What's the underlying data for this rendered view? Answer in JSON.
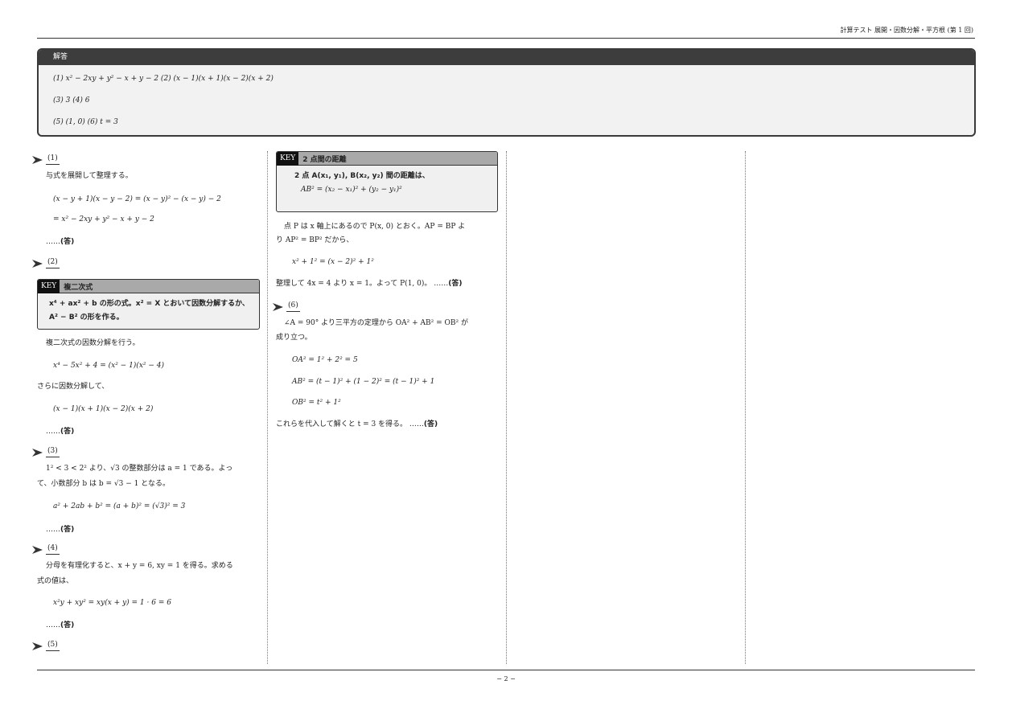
{
  "header": {
    "running_title": "計算テスト 展開・因数分解・平方根 (第 1 回)"
  },
  "answers": {
    "title": "解答",
    "line1": "(1) x² − 2xy + y² − x + y − 2    (2) (x − 1)(x + 1)(x − 2)(x + 2)",
    "line2": "(3) 3    (4) 6",
    "line3": "(5) (1, 0)    (6) t = 3"
  },
  "col1": {
    "q1": {
      "num": "(1)",
      "intro": "与式を展開して整理する。",
      "eq1": "(x − y + 1)(x − y − 2) = (x − y)² − (x − y) − 2",
      "eq2": "= x² − 2xy + y² − x + y − 2",
      "ans_dots": "……",
      "ans_mark": "(答)"
    },
    "q2": {
      "num": "(2)",
      "key_tag": "KEY",
      "key_title": "複二次式",
      "key_body": "x⁴ + ax² + b の形の式。x² = X とおいて因数分解するか、A² − B² の形を作る。",
      "text1": "複二次式の因数分解を行う。",
      "eq1": "x⁴ − 5x² + 4 = (x² − 1)(x² − 4)",
      "text2": "さらに因数分解して、",
      "eq2": "(x − 1)(x + 1)(x − 2)(x + 2)",
      "ans_dots": "……",
      "ans_mark": "(答)"
    },
    "q3": {
      "num": "(3)",
      "text1": "1² < 3 < 2² より、√3 の整数部分は a = 1 である。よっ",
      "text2": "て、小数部分 b は b = √3 − 1 となる。",
      "eq1": "a² + 2ab + b² = (a + b)² = (√3)² = 3",
      "ans_dots": "……",
      "ans_mark": "(答)"
    },
    "q4": {
      "num": "(4)",
      "text1": "分母を有理化すると、x + y = 6, xy = 1 を得る。求める",
      "text2": "式の値は、",
      "eq1": "x²y + xy² = xy(x + y) = 1 · 6 = 6",
      "ans_dots": "……",
      "ans_mark": "(答)"
    },
    "q5": {
      "num": "(5)"
    }
  },
  "col2": {
    "key": {
      "tag": "KEY",
      "title": "2 点間の距離",
      "body": "2 点 A(x₁, y₁), B(x₂, y₂) 間の距離は、",
      "formula": "AB² = (x₂ − x₁)² + (y₂ − y₁)²"
    },
    "q5": {
      "text1": "点 P は x 軸上にあるので P(x, 0) とおく。AP = BP よ",
      "text2": "り AP² = BP² だから、",
      "eq1": "x² + 1² = (x − 2)² + 1²",
      "conclusion": "整理して 4x = 4 より x = 1。よって P(1, 0)。 ……",
      "ans_mark": "(答)"
    },
    "q6": {
      "num": "(6)",
      "text1": "∠A = 90° より三平方の定理から OA² + AB² = OB² が",
      "text2": "成り立つ。",
      "eq1": "OA² = 1² + 2² = 5",
      "eq2": "AB² = (t − 1)² + (1 − 2)² = (t − 1)² + 1",
      "eq3": "OB² = t² + 1²",
      "conclusion": "これらを代入して解くと t = 3 を得る。 ……",
      "ans_mark": "(答)"
    }
  },
  "footer": {
    "page_number": "− 2 −"
  }
}
